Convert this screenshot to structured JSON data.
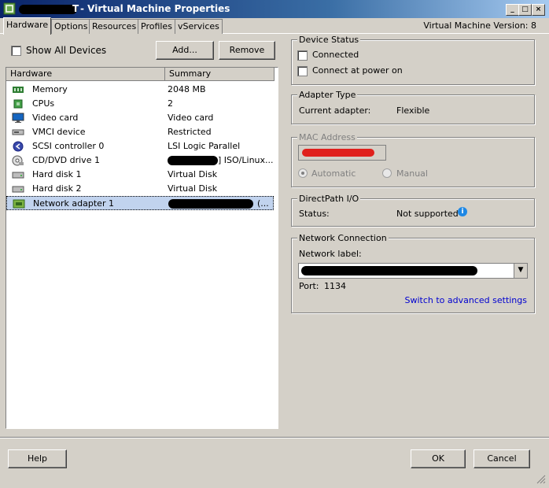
{
  "window": {
    "title": "Virtual Machine Properties",
    "title_prefix_visible": "T",
    "vm_version": "Virtual Machine Version: 8",
    "controls": [
      "_",
      "□",
      "×"
    ]
  },
  "tabs": [
    {
      "label": "Hardware",
      "active": true
    },
    {
      "label": "Options",
      "active": false
    },
    {
      "label": "Resources",
      "active": false
    },
    {
      "label": "Profiles",
      "active": false
    },
    {
      "label": "vServices",
      "active": false
    }
  ],
  "left": {
    "show_all_devices": "Show All Devices",
    "add_button": "Add...",
    "remove_button": "Remove",
    "columns": [
      "Hardware",
      "Summary"
    ],
    "rows": [
      {
        "name": "Memory",
        "summary": "2048 MB",
        "icon": "memory-icon"
      },
      {
        "name": "CPUs",
        "summary": "2",
        "icon": "cpu-icon"
      },
      {
        "name": "Video card",
        "summary": "Video card",
        "icon": "monitor-icon"
      },
      {
        "name": "VMCI device",
        "summary": "Restricted",
        "icon": "device-icon"
      },
      {
        "name": "SCSI controller 0",
        "summary": "LSI Logic Parallel",
        "icon": "scsi-icon"
      },
      {
        "name": "CD/DVD drive 1",
        "summary": "] ISO/Linux...",
        "icon": "cd-drive-icon"
      },
      {
        "name": "Hard disk 1",
        "summary": "Virtual Disk",
        "icon": "hard-disk-icon"
      },
      {
        "name": "Hard disk 2",
        "summary": "Virtual Disk",
        "icon": "hard-disk-icon"
      },
      {
        "name": "Network adapter 1",
        "summary": "(...",
        "icon": "network-adapter-icon"
      }
    ]
  },
  "device_status": {
    "legend": "Device Status",
    "connected": "Connected",
    "connect_at_power_on": "Connect at power on"
  },
  "adapter_type": {
    "legend": "Adapter Type",
    "current_label": "Current adapter:",
    "current_value": "Flexible"
  },
  "mac_address": {
    "legend": "MAC Address",
    "automatic": "Automatic",
    "manual": "Manual"
  },
  "directpath": {
    "legend": "DirectPath I/O",
    "status_label": "Status:",
    "status_value": "Not supported"
  },
  "network_connection": {
    "legend": "Network Connection",
    "network_label": "Network label:",
    "port_label": "Port:",
    "port_value": "1134",
    "advanced_link": "Switch to advanced settings"
  },
  "footer": {
    "help": "Help",
    "ok": "OK",
    "cancel": "Cancel"
  },
  "colors": {
    "title_start": "#0a246a",
    "title_end": "#a6caf0",
    "selection": "#c1d3ee",
    "link": "#0000d0",
    "redaction_red": "#e0201c"
  }
}
